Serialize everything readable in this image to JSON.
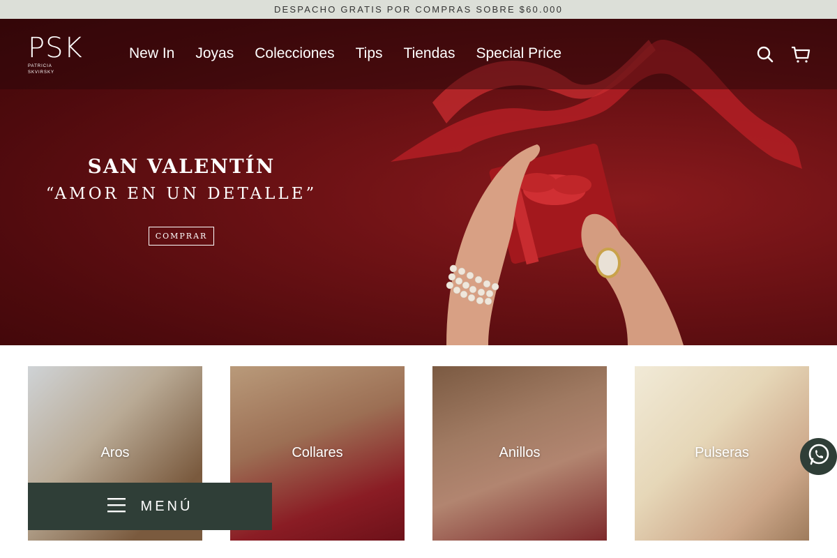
{
  "announcement": "DESPACHO GRATIS POR COMPRAS SOBRE $60.000",
  "logo": {
    "main": "PSK",
    "sub_line1": "PATRICIA",
    "sub_line2": "SKVIRSKY"
  },
  "nav": [
    "New In",
    "Joyas",
    "Colecciones",
    "Tips",
    "Tiendas",
    "Special Price"
  ],
  "header_icons": [
    "search-icon",
    "cart-icon"
  ],
  "hero": {
    "title": "SAN VALENTÍN",
    "subtitle": "“AMOR EN UN DETALLE”",
    "button": "COMPRAR"
  },
  "categories": [
    {
      "label": "Aros"
    },
    {
      "label": "Collares"
    },
    {
      "label": "Anillos"
    },
    {
      "label": "Pulseras"
    }
  ],
  "menu_button": {
    "label": "MENÚ",
    "icon": "hamburger-icon"
  },
  "whatsapp": {
    "icon": "whatsapp-icon"
  },
  "colors": {
    "announce_bg": "#dcdfd8",
    "hero_red": "#6e1215",
    "menu_bg": "#2f3e37"
  }
}
